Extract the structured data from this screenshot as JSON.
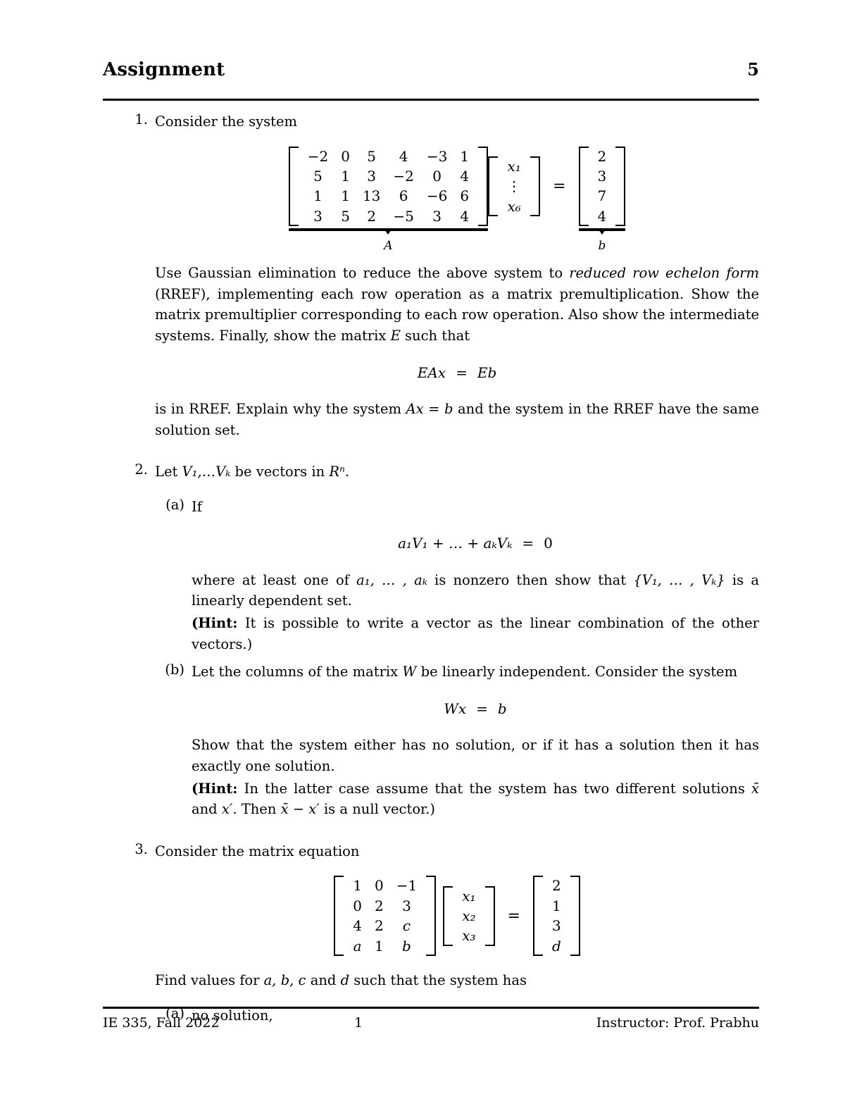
{
  "header": {
    "title": "Assignment",
    "page_label": "5"
  },
  "footer": {
    "left": "IE 335, Fall 2022",
    "center": "1",
    "right": "Instructor: Prof. Prabhu"
  },
  "problems": {
    "p1": {
      "number": "1.",
      "stem": "Consider the system",
      "matrix_A": {
        "rows": [
          [
            "−2",
            "0",
            "5",
            "4",
            "−3",
            "1"
          ],
          [
            "5",
            "1",
            "3",
            "−2",
            "0",
            "4"
          ],
          [
            "1",
            "1",
            "13",
            "6",
            "−6",
            "6"
          ],
          [
            "3",
            "5",
            "2",
            "−5",
            "3",
            "4"
          ]
        ],
        "label": "A"
      },
      "vector_x": {
        "entries": [
          "x₁",
          "⋮",
          "x₆"
        ]
      },
      "equals": "=",
      "vector_b": {
        "entries": [
          "2",
          "3",
          "7",
          "4"
        ],
        "label": "b"
      },
      "body_line1": "Use Gaussian elimination to reduce the above system to ",
      "body_emph": "reduced row echelon form",
      "body_line2": " (RREF), implementing each row operation as a matrix premultiplication. Show the matrix premultiplier corresponding to each row operation. Also show the intermediate systems. Finally, show the matrix ",
      "body_var_E": "E",
      "body_line3": " such that",
      "display_eq": {
        "lhs": "EAx",
        "rel": "=",
        "rhs": "Eb"
      },
      "tail_1": "is in RREF. Explain why the system ",
      "tail_eq": "Ax = b",
      "tail_2": " and the system in the RREF have the same solution set."
    },
    "p2": {
      "number": "2.",
      "stem_1": "Let ",
      "stem_vectors": "V₁,…Vₖ",
      "stem_2": " be vectors in ",
      "stem_space": "Rⁿ",
      "stem_3": ".",
      "a": {
        "label": "(a)",
        "intro": "If",
        "display_eq": {
          "lhs": "a₁V₁ + … + aₖVₖ",
          "rel": "=",
          "rhs": "0"
        },
        "body_1": "where at least one of ",
        "body_coeffs": "a₁, … , aₖ",
        "body_2": " is nonzero then show that ",
        "body_set": "{V₁, … , Vₖ}",
        "body_3": " is a linearly dependent set.",
        "hint_label": "(Hint:",
        "hint_text": " It is possible to write a vector as the linear combination of the other vectors.)"
      },
      "b": {
        "label": "(b)",
        "body_1": "Let the columns of the matrix ",
        "body_var_W": "W",
        "body_2": " be linearly independent. Consider the system",
        "display_eq": {
          "lhs": "Wx",
          "rel": "=",
          "rhs": "b"
        },
        "body_3": "Show that the system either has no solution, or if it has a solution then it has exactly one solution.",
        "hint_label": "(Hint:",
        "hint_text_1": " In the latter case assume that the system has two different solutions ",
        "hint_xbar": "x̄",
        "hint_text_2": " and ",
        "hint_xprime": "x′",
        "hint_text_3": ". Then ",
        "hint_diff": "x̄ − x′",
        "hint_text_4": " is a null vector.)"
      }
    },
    "p3": {
      "number": "3.",
      "stem": "Consider the matrix equation",
      "matrix_M": {
        "rows": [
          [
            "1",
            "0",
            "−1"
          ],
          [
            "0",
            "2",
            "3"
          ],
          [
            "4",
            "2",
            "c"
          ],
          [
            "a",
            "1",
            "b"
          ]
        ],
        "italic_cells": [
          "2,2",
          "3,0",
          "3,2"
        ]
      },
      "vector_x": {
        "entries": [
          "x₁",
          "x₂",
          "x₃"
        ]
      },
      "equals": "=",
      "vector_rhs": {
        "entries": [
          "2",
          "1",
          "3",
          "d"
        ]
      },
      "tail_1": "Find values for ",
      "tail_vars": "a, b, c",
      "tail_2": " and ",
      "tail_var_d": "d",
      "tail_3": " such that the system has",
      "a": {
        "label": "(a)",
        "text": "no solution,"
      }
    }
  }
}
